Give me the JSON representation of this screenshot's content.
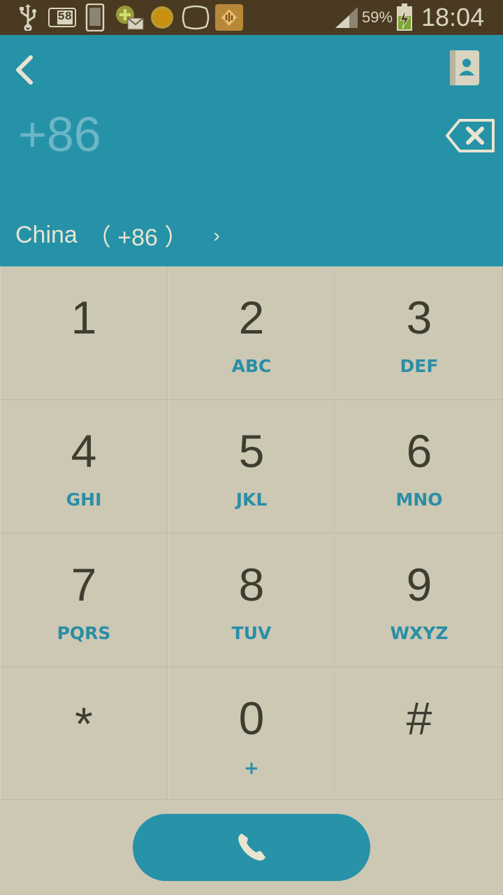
{
  "status_bar": {
    "battery_percent": "59%",
    "time": "18:04",
    "notification_badge": "58",
    "icons": [
      "usb-icon",
      "sim-badge-icon",
      "phone-icon",
      "app-mail-icon",
      "sun-icon",
      "chat-bubble-icon",
      "music-app-icon",
      "signal-icon",
      "battery-charging-icon"
    ]
  },
  "header": {
    "background_color": "#2592a8",
    "number": "+86",
    "country": "China",
    "country_code": "（ +86 ）",
    "chevron": "›",
    "icons": {
      "back": "back-arrow-icon",
      "contacts": "contacts-book-icon",
      "backspace": "backspace-icon"
    }
  },
  "keypad": {
    "keys": [
      {
        "digit": "1",
        "letters": ""
      },
      {
        "digit": "2",
        "letters": "ABC"
      },
      {
        "digit": "3",
        "letters": "DEF"
      },
      {
        "digit": "4",
        "letters": "GHI"
      },
      {
        "digit": "5",
        "letters": "JKL"
      },
      {
        "digit": "6",
        "letters": "MNO"
      },
      {
        "digit": "7",
        "letters": "PQRS"
      },
      {
        "digit": "8",
        "letters": "TUV"
      },
      {
        "digit": "9",
        "letters": "WXYZ"
      },
      {
        "digit": "*",
        "letters": ""
      },
      {
        "digit": "0",
        "letters": "+"
      },
      {
        "digit": "#",
        "letters": ""
      }
    ],
    "letter_color": "#2a8ea6",
    "background_color": "#ccc8b4"
  },
  "call_button": {
    "icon": "phone-call-icon",
    "color": "#2792a8"
  }
}
